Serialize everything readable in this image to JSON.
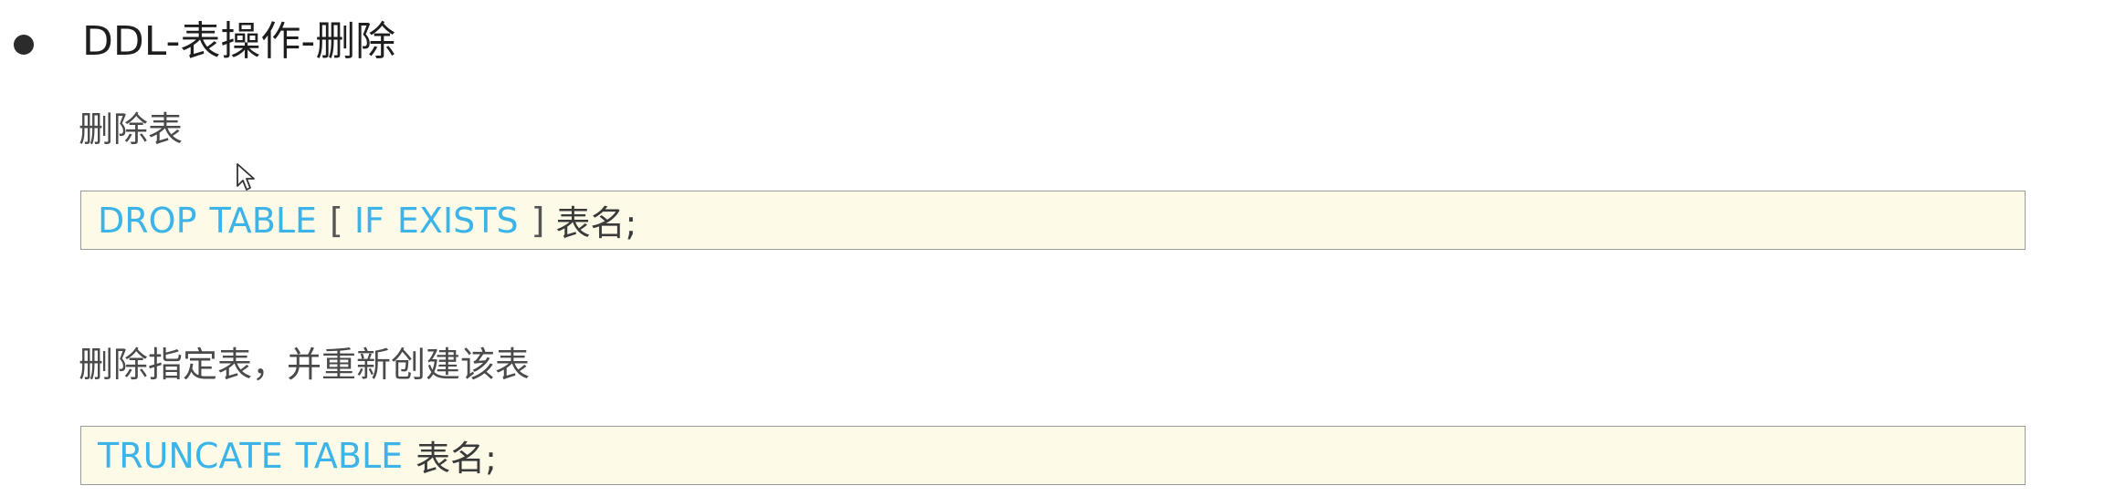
{
  "section": {
    "heading": "DDL-表操作-删除"
  },
  "drop_table": {
    "label": "删除表",
    "code": {
      "keyword1": "DROP",
      "keyword2": "TABLE",
      "open_bracket": "[",
      "keyword3": "IF",
      "keyword4": "EXISTS",
      "close_bracket": "]",
      "table_name": "表名;"
    }
  },
  "truncate_table": {
    "label": "删除指定表，并重新创建该表",
    "code": {
      "keyword1": "TRUNCATE",
      "keyword2": "TABLE",
      "table_name": "表名;"
    }
  },
  "colors": {
    "keyword": "#3cb4e8",
    "code_background": "#fdfbe8"
  },
  "icons": {
    "bullet": "bullet-icon",
    "cursor": "mouse-cursor-icon"
  }
}
